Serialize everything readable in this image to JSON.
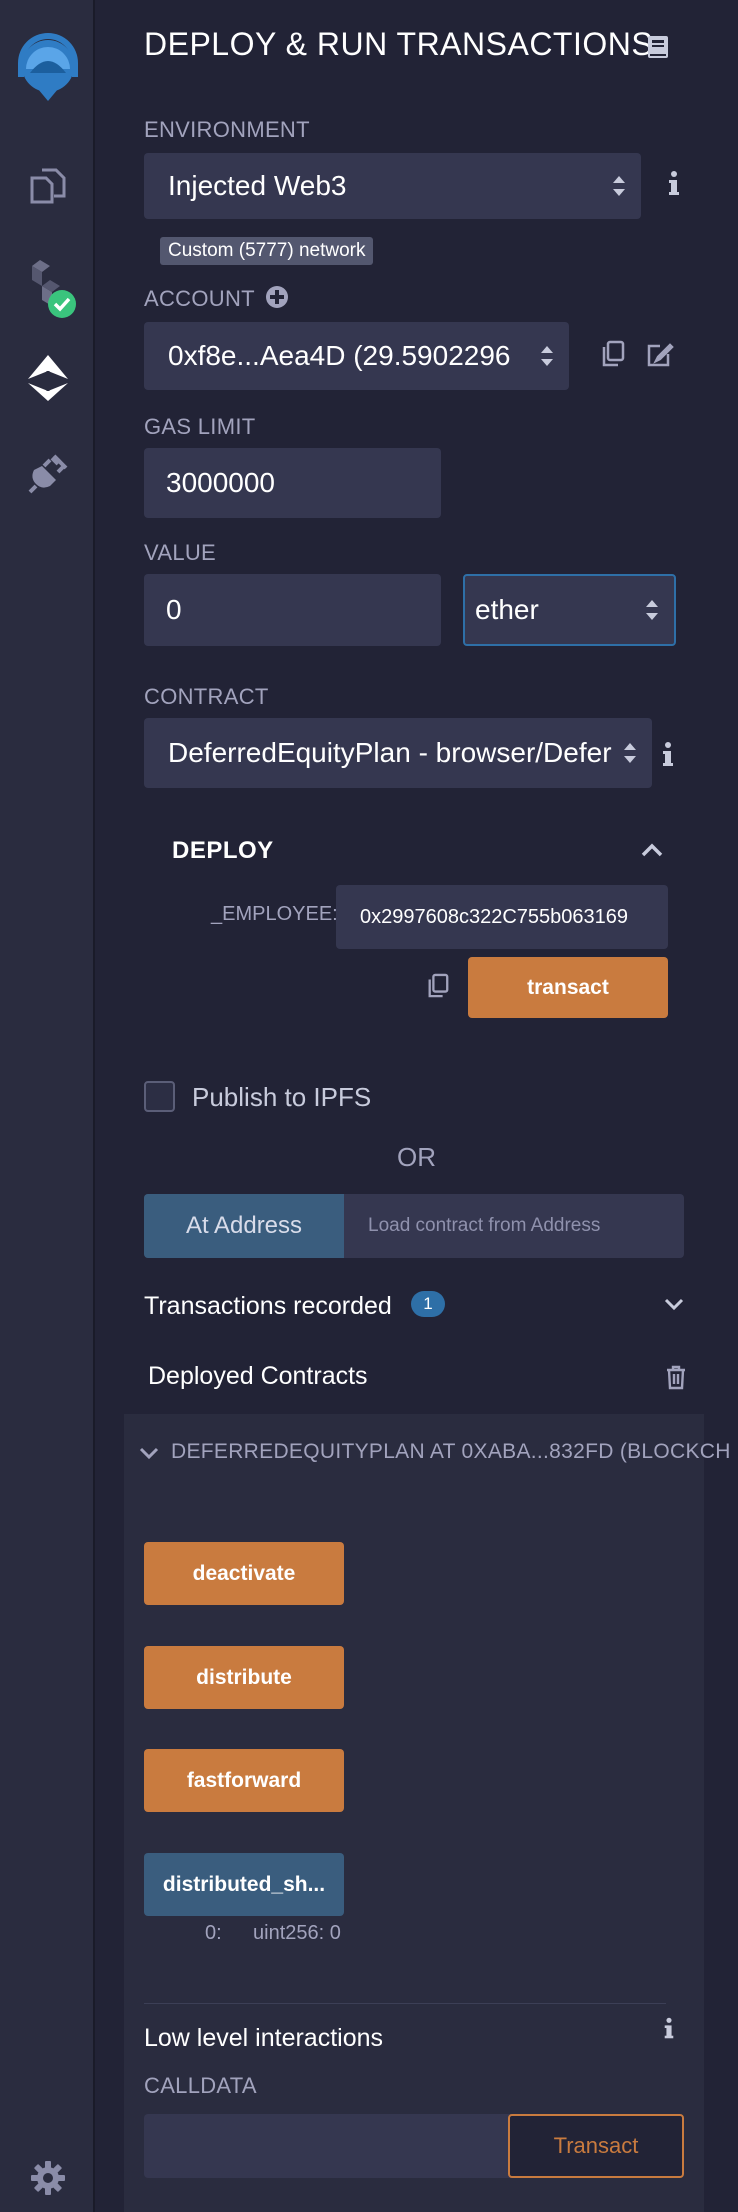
{
  "sidebar": {
    "items": [
      {
        "icon": "remix-logo-icon"
      },
      {
        "icon": "file-explorer-icon"
      },
      {
        "icon": "solidity-compiler-icon"
      },
      {
        "icon": "deploy-run-icon"
      },
      {
        "icon": "plugin-manager-icon"
      },
      {
        "icon": "settings-icon"
      }
    ]
  },
  "header": {
    "title": "DEPLOY & RUN TRANSACTIONS",
    "doc_icon": "book-icon"
  },
  "environment": {
    "label": "ENVIRONMENT",
    "value": "Injected Web3",
    "network_badge": "Custom (5777) network"
  },
  "account": {
    "label": "ACCOUNT",
    "value": "0xf8e...Aea4D (29.5902296"
  },
  "gas_limit": {
    "label": "GAS LIMIT",
    "value": "3000000"
  },
  "value": {
    "label": "VALUE",
    "amount": "0",
    "unit": "ether"
  },
  "contract": {
    "label": "CONTRACT",
    "value": "DeferredEquityPlan - browser/Defer"
  },
  "deploy": {
    "title": "DEPLOY",
    "employee_label": "_EMPLOYEE:",
    "employee_value": "0x2997608c322C755b063169",
    "transact_label": "transact"
  },
  "publish": {
    "label": "Publish to IPFS"
  },
  "or_text": "OR",
  "at_address": {
    "button": "At Address",
    "placeholder": "Load contract from Address"
  },
  "transactions": {
    "label": "Transactions recorded",
    "count": "1"
  },
  "deployed": {
    "label": "Deployed Contracts",
    "instance_title": "DEFERREDEQUITYPLAN AT 0XABA...832FD (BLOCKCH",
    "functions": [
      {
        "label": "deactivate",
        "kind": "transact"
      },
      {
        "label": "distribute",
        "kind": "transact"
      },
      {
        "label": "fastforward",
        "kind": "transact"
      },
      {
        "label": "distributed_sh...",
        "kind": "call"
      }
    ],
    "output_index": "0:",
    "output_value": "uint256: 0"
  },
  "low_level": {
    "label": "Low level interactions",
    "calldata_label": "CALLDATA",
    "transact_label": "Transact"
  },
  "colors": {
    "background": "#222336",
    "rail": "#2a2c3f",
    "input": "#353750",
    "orange": "#c97b3f",
    "blue": "#3a5d7e",
    "check_green": "#3ac47d"
  }
}
